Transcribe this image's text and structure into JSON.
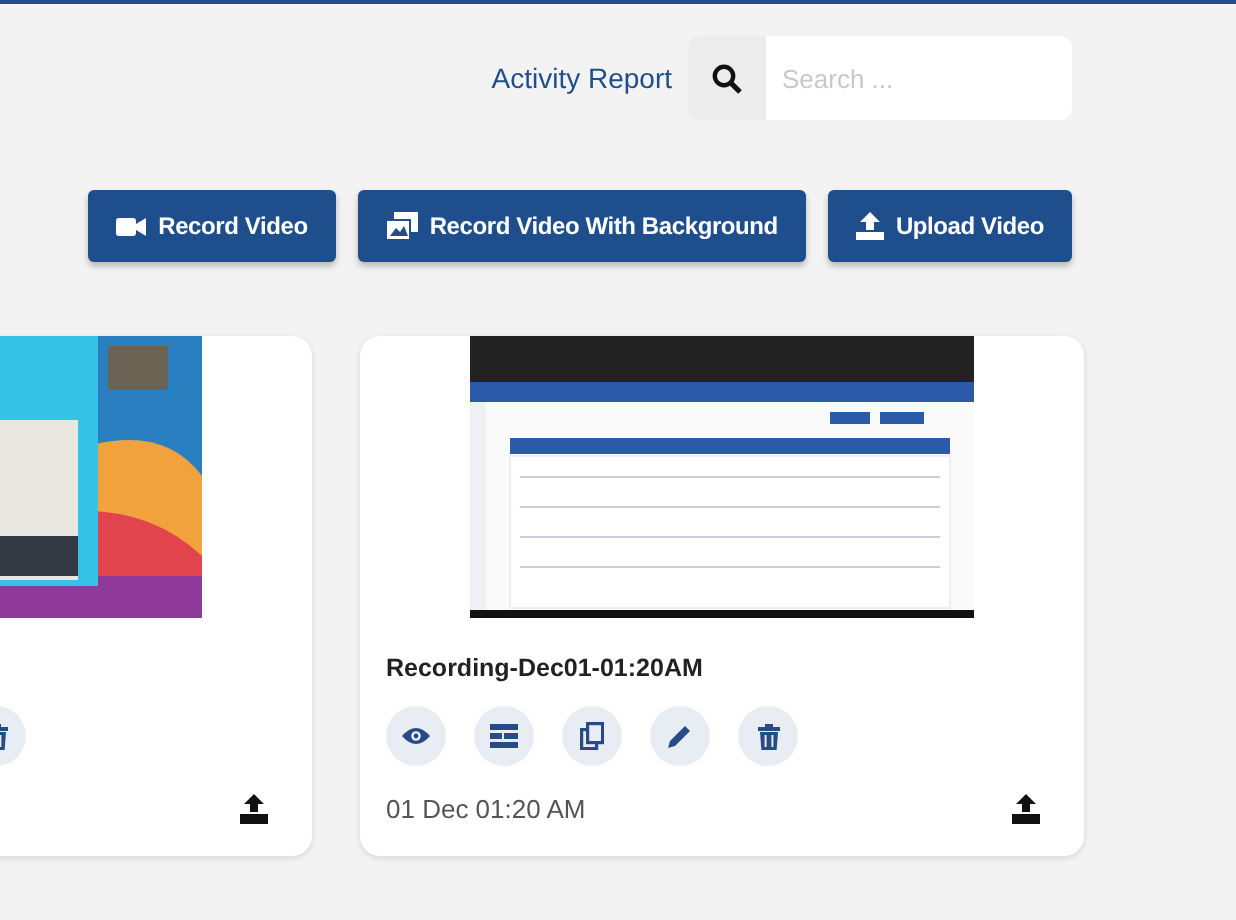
{
  "header": {
    "link": "Activity Report",
    "search": {
      "placeholder": "Search ..."
    }
  },
  "toolbar": [
    {
      "kind": "record",
      "label": "Record Video"
    },
    {
      "kind": "background",
      "label": "Record Video With Background"
    },
    {
      "kind": "upload",
      "label": "Upload Video"
    }
  ],
  "recordings": [
    {
      "kind": "picture",
      "actions": [
        {
          "kind": "delete"
        }
      ]
    },
    {
      "kind": "picture",
      "title": "Recording-Dec01-01:20AM",
      "actions": [
        {
          "kind": "view"
        },
        {
          "kind": "details"
        },
        {
          "kind": "copy"
        },
        {
          "kind": "edit"
        },
        {
          "kind": "delete"
        }
      ],
      "date": "01 Dec 01:20 AM"
    }
  ]
}
